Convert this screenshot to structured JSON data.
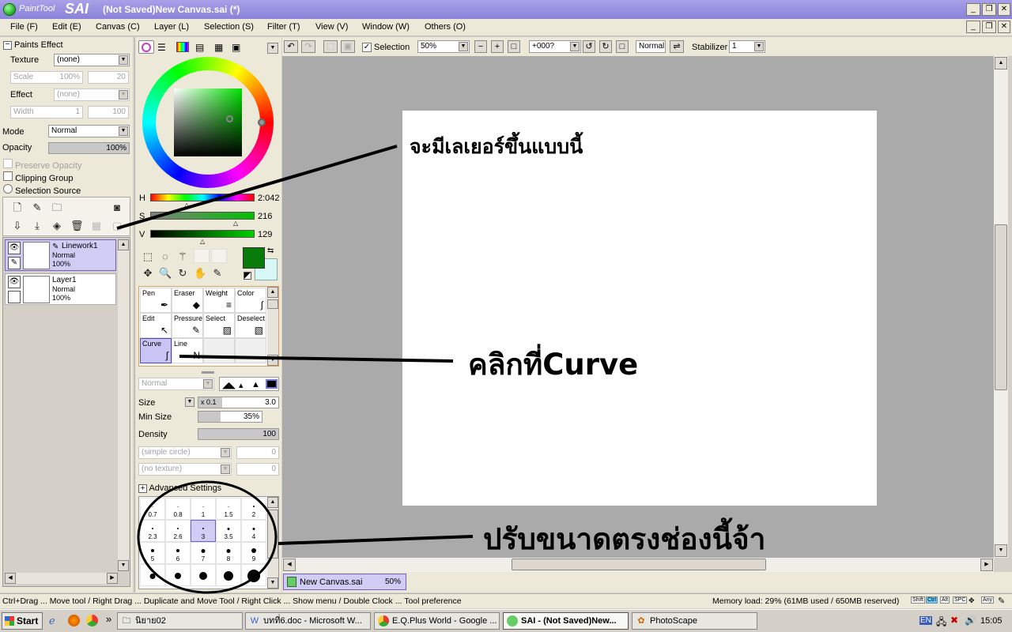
{
  "window": {
    "logo_small": "PaintTool",
    "logo_big": "SAI",
    "title": "(Not Saved)New Canvas.sai (*)"
  },
  "menu": [
    "File (F)",
    "Edit (E)",
    "Canvas (C)",
    "Layer (L)",
    "Selection (S)",
    "Filter (T)",
    "View (V)",
    "Window (W)",
    "Others (O)"
  ],
  "paints_effect": {
    "header": "Paints Effect",
    "texture_label": "Texture",
    "texture_value": "(none)",
    "scale_label": "Scale",
    "scale_value": "100%",
    "scale_num": "20",
    "effect_label": "Effect",
    "effect_value": "(none)",
    "width_label": "Width",
    "width_value": "1",
    "width_num": "100"
  },
  "layer_props": {
    "mode_label": "Mode",
    "mode_value": "Normal",
    "opacity_label": "Opacity",
    "opacity_value": "100%",
    "preserve": "Preserve Opacity",
    "clipping": "Clipping Group",
    "selection_source": "Selection Source"
  },
  "layers": [
    {
      "name": "Linework1",
      "mode": "Normal",
      "opacity": "100%",
      "selected": true
    },
    {
      "name": "Layer1",
      "mode": "Normal",
      "opacity": "100%",
      "selected": false
    }
  ],
  "color": {
    "h_label": "H",
    "h_value": "2:042",
    "s_label": "S",
    "s_value": "216",
    "v_label": "V",
    "v_value": "129",
    "primary": "#0a7a0a",
    "secondary": "#d8f8f8"
  },
  "tools": [
    {
      "name": "Pen",
      "icon": "✒"
    },
    {
      "name": "Eraser",
      "icon": "◆"
    },
    {
      "name": "Weight",
      "icon": "≡"
    },
    {
      "name": "Color",
      "icon": "∫"
    },
    {
      "name": "Edit",
      "icon": "↖"
    },
    {
      "name": "Pressure",
      "icon": "✎"
    },
    {
      "name": "Select",
      "icon": "▨"
    },
    {
      "name": "Deselect",
      "icon": "▧"
    },
    {
      "name": "Curve",
      "icon": "∫"
    },
    {
      "name": "Line",
      "icon": "N"
    }
  ],
  "brush": {
    "mode_value": "Normal",
    "size_label": "Size",
    "size_mult": "x 0.1",
    "size_value": "3.0",
    "min_size_label": "Min Size",
    "min_size_value": "35%",
    "density_label": "Density",
    "density_value": "100",
    "shape_value": "(simple circle)",
    "shape_num": "0",
    "texture_value": "(no texture)",
    "texture_num": "0",
    "advanced": "Advanced Settings",
    "sizes": [
      "0.7",
      "0.8",
      "1",
      "1.5",
      "2",
      "2.3",
      "2.6",
      "3",
      "3.5",
      "4",
      "5",
      "6",
      "7",
      "8",
      "9",
      "",
      "",
      "",
      "",
      ""
    ]
  },
  "toolbar": {
    "selection_label": "Selection",
    "zoom": "50%",
    "angle": "+000?",
    "blend": "Normal",
    "stabilizer_label": "Stabilizer",
    "stabilizer_value": "1"
  },
  "canvas_tab": {
    "name": "New Canvas.sai",
    "zoom": "50%"
  },
  "status": {
    "hint": "Ctrl+Drag ... Move tool / Right Drag ... Duplicate and Move Tool / Right Click ... Show menu / Double Clock ... Tool preference",
    "memory": "Memory load: 29% (61MB used / 650MB reserved)",
    "keys": [
      "Shift",
      "Ctrl",
      "Alt",
      "SPC",
      "Any"
    ]
  },
  "annotations": {
    "layer_note": "จะมีเลเยอร์ขึ้นแบบนี้",
    "curve_note": "คลิกที่Curve",
    "size_note": "ปรับขนาดตรงช่องนี้จ้า"
  },
  "taskbar": {
    "start": "Start",
    "tasks": [
      "นิยาย02",
      "บทที่6.doc - Microsoft W...",
      "E.Q.Plus World - Google ...",
      "SAI - (Not Saved)New...",
      "PhotoScape"
    ],
    "lang": "EN",
    "clock": "15:05"
  }
}
